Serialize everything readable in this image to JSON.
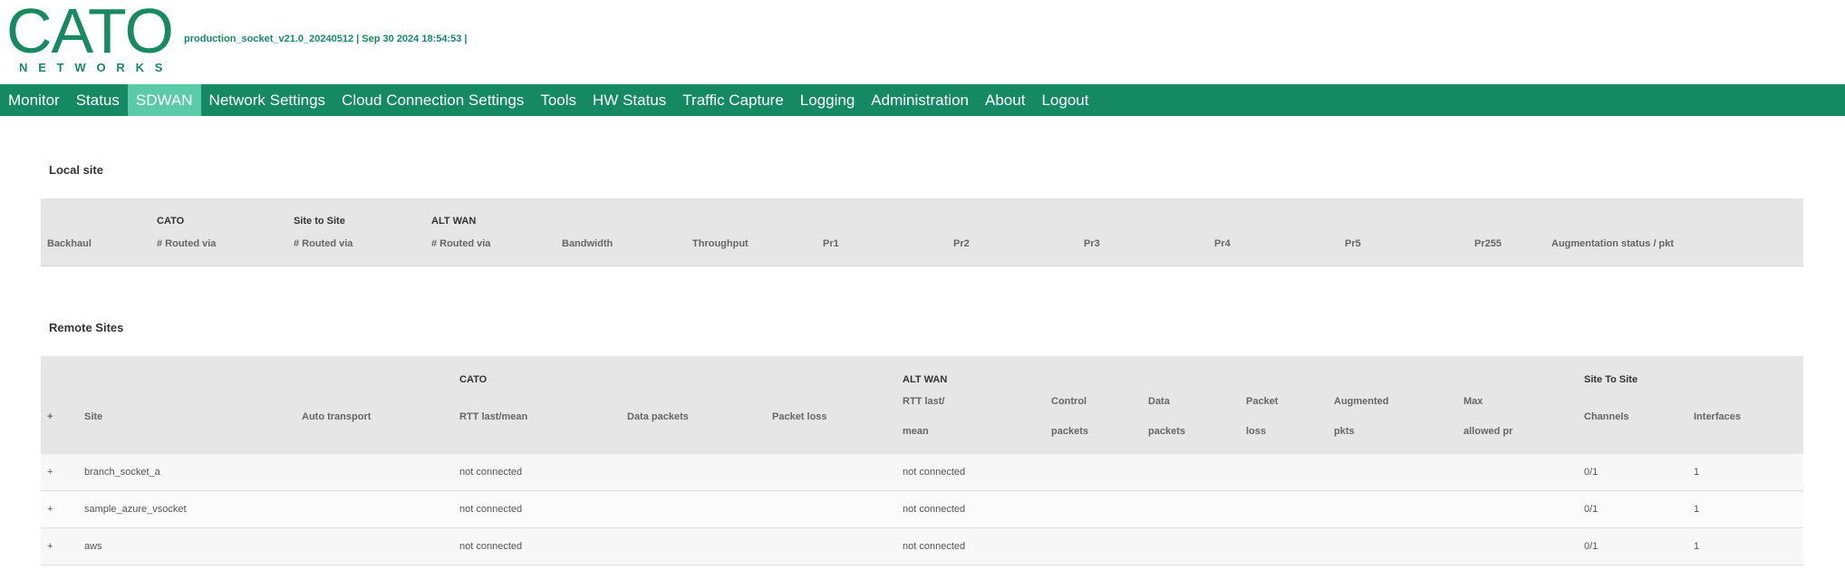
{
  "header": {
    "logo_word": "CATO",
    "logo_sub": "NETWORKS",
    "version": "production_socket_v21.0_20240512 | Sep 30 2024 18:54:53 |"
  },
  "nav": {
    "items": [
      "Monitor",
      "Status",
      "SDWAN",
      "Network Settings",
      "Cloud Connection Settings",
      "Tools",
      "HW Status",
      "Traffic Capture",
      "Logging",
      "Administration",
      "About",
      "Logout"
    ],
    "active": "SDWAN"
  },
  "local_site": {
    "title": "Local site",
    "group_headers": {
      "cato": "CATO",
      "site_to_site": "Site to Site",
      "alt_wan": "ALT WAN"
    },
    "columns": [
      "Backhaul",
      "# Routed via",
      "# Routed via",
      "# Routed via",
      "Bandwidth",
      "Throughput",
      "Pr1",
      "Pr2",
      "Pr3",
      "Pr4",
      "Pr5",
      "Pr255",
      "Augmentation status / pkt"
    ]
  },
  "remote_sites": {
    "title": "Remote Sites",
    "group_headers": {
      "cato": "CATO",
      "alt_wan": "ALT WAN",
      "site_to_site": "Site To Site"
    },
    "columns": {
      "expand": "+",
      "site": "Site",
      "auto_transport": "Auto transport",
      "cato_rtt": "RTT last/mean",
      "cato_data_packets": "Data packets",
      "cato_packet_loss": "Packet loss",
      "alt_rtt_1": "RTT last/",
      "alt_rtt_2": "mean",
      "control_1": "Control",
      "control_2": "packets",
      "data_1": "Data",
      "data_2": "packets",
      "loss_1": "Packet",
      "loss_2": "loss",
      "aug_1": "Augmented",
      "aug_2": "pkts",
      "max_1": "Max",
      "max_2": "allowed pr",
      "channels": "Channels",
      "interfaces": "Interfaces"
    },
    "rows": [
      {
        "expand": "+",
        "site": "branch_socket_a",
        "cato_rtt": "not connected",
        "alt_rtt": "not connected",
        "channels": "0/1",
        "interfaces": "1"
      },
      {
        "expand": "+",
        "site": "sample_azure_vsocket",
        "cato_rtt": "not connected",
        "alt_rtt": "not connected",
        "channels": "0/1",
        "interfaces": "1"
      },
      {
        "expand": "+",
        "site": "aws",
        "cato_rtt": "not connected",
        "alt_rtt": "not connected",
        "channels": "0/1",
        "interfaces": "1"
      }
    ]
  },
  "colors": {
    "brand": "#158962",
    "nav_active": "#5bcba7",
    "header_bg": "#e6e6e6"
  }
}
